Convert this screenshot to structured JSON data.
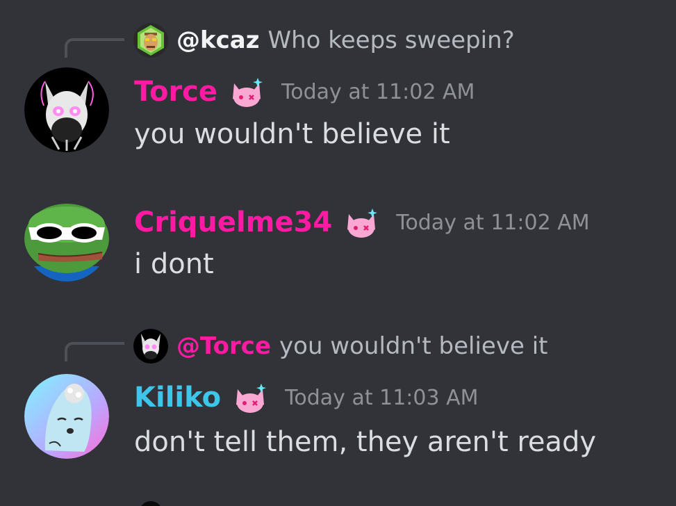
{
  "messages": [
    {
      "reply": {
        "author": "@kcaz",
        "text": "Who keeps sweepin?"
      },
      "author": "Torce",
      "timestamp": "Today at 11:02 AM",
      "content": "you wouldn't believe it"
    },
    {
      "author": "Criquelme34",
      "timestamp": "Today at 11:02 AM",
      "content": "i dont"
    },
    {
      "reply": {
        "author": "@Torce",
        "text": "you wouldn't believe it"
      },
      "author": "Kiliko",
      "timestamp": "Today at 11:03 AM",
      "content": "don't tell them, they aren't ready"
    }
  ],
  "colors": {
    "background": "#313338",
    "username_pink": "#ff1aa3",
    "username_cyan": "#3ec6ea",
    "timestamp": "#8e9297",
    "message_text": "#dbdee1",
    "reply_text": "#b5bac1",
    "reply_spine": "#4e5058"
  },
  "icons": {
    "badge": "pink-cat-badge-icon",
    "avatar_torce": "skull-avatar",
    "avatar_criquelme34": "pepe-frog-sunglasses-avatar",
    "avatar_kiliko": "cartoon-creature-avatar",
    "avatar_kcaz": "pixel-ape-avatar"
  }
}
